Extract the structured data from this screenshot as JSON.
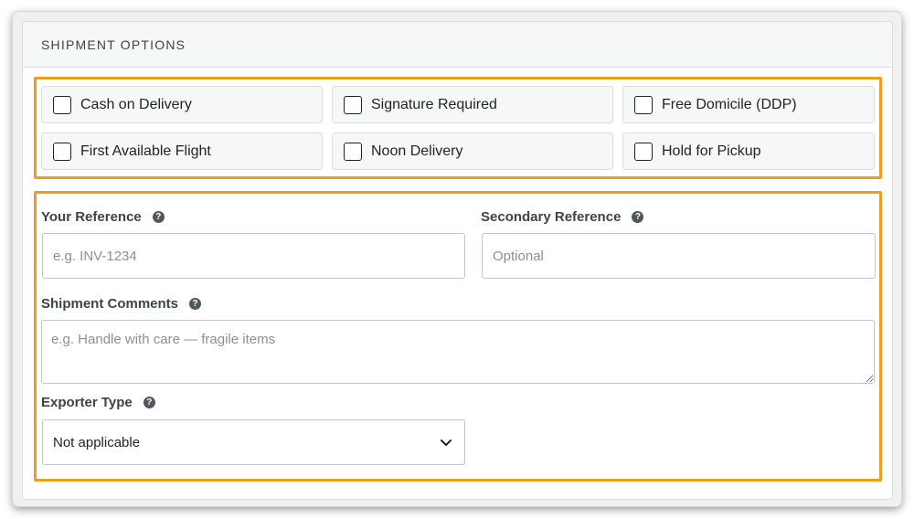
{
  "panel": {
    "title": "SHIPMENT OPTIONS"
  },
  "options": [
    {
      "label": "Cash on Delivery",
      "checked": false
    },
    {
      "label": "Signature Required",
      "checked": false
    },
    {
      "label": "Free Domicile (DDP)",
      "checked": false
    },
    {
      "label": "First Available Flight",
      "checked": false
    },
    {
      "label": "Noon Delivery",
      "checked": false
    },
    {
      "label": "Hold for Pickup",
      "checked": false
    }
  ],
  "fields": {
    "your_reference": {
      "label": "Your Reference",
      "placeholder": "e.g. INV-1234",
      "value": ""
    },
    "secondary_reference": {
      "label": "Secondary Reference",
      "placeholder": "Optional",
      "value": ""
    },
    "shipment_comments": {
      "label": "Shipment Comments",
      "placeholder": "e.g. Handle with care — fragile items",
      "value": ""
    },
    "exporter_type": {
      "label": "Exporter Type",
      "selected": "Not applicable"
    }
  },
  "icons": {
    "help": "help-icon",
    "checkbox": "checkbox-icon",
    "dropdown": "chevron-down-icon"
  },
  "colors": {
    "highlight": "#f29c1f",
    "help_icon_bg": "#50575e"
  }
}
